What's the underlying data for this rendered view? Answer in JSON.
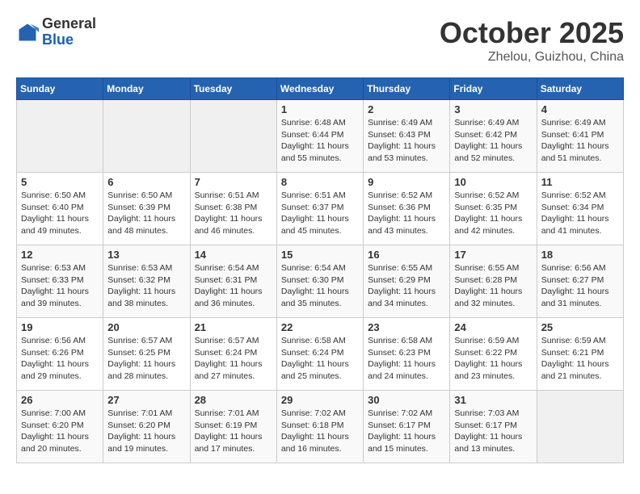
{
  "header": {
    "logo_general": "General",
    "logo_blue": "Blue",
    "title": "October 2025",
    "subtitle": "Zhelou, Guizhou, China"
  },
  "days_of_week": [
    "Sunday",
    "Monday",
    "Tuesday",
    "Wednesday",
    "Thursday",
    "Friday",
    "Saturday"
  ],
  "weeks": [
    [
      {
        "day": "",
        "info": ""
      },
      {
        "day": "",
        "info": ""
      },
      {
        "day": "",
        "info": ""
      },
      {
        "day": "1",
        "info": "Sunrise: 6:48 AM\nSunset: 6:44 PM\nDaylight: 11 hours\nand 55 minutes."
      },
      {
        "day": "2",
        "info": "Sunrise: 6:49 AM\nSunset: 6:43 PM\nDaylight: 11 hours\nand 53 minutes."
      },
      {
        "day": "3",
        "info": "Sunrise: 6:49 AM\nSunset: 6:42 PM\nDaylight: 11 hours\nand 52 minutes."
      },
      {
        "day": "4",
        "info": "Sunrise: 6:49 AM\nSunset: 6:41 PM\nDaylight: 11 hours\nand 51 minutes."
      }
    ],
    [
      {
        "day": "5",
        "info": "Sunrise: 6:50 AM\nSunset: 6:40 PM\nDaylight: 11 hours\nand 49 minutes."
      },
      {
        "day": "6",
        "info": "Sunrise: 6:50 AM\nSunset: 6:39 PM\nDaylight: 11 hours\nand 48 minutes."
      },
      {
        "day": "7",
        "info": "Sunrise: 6:51 AM\nSunset: 6:38 PM\nDaylight: 11 hours\nand 46 minutes."
      },
      {
        "day": "8",
        "info": "Sunrise: 6:51 AM\nSunset: 6:37 PM\nDaylight: 11 hours\nand 45 minutes."
      },
      {
        "day": "9",
        "info": "Sunrise: 6:52 AM\nSunset: 6:36 PM\nDaylight: 11 hours\nand 43 minutes."
      },
      {
        "day": "10",
        "info": "Sunrise: 6:52 AM\nSunset: 6:35 PM\nDaylight: 11 hours\nand 42 minutes."
      },
      {
        "day": "11",
        "info": "Sunrise: 6:52 AM\nSunset: 6:34 PM\nDaylight: 11 hours\nand 41 minutes."
      }
    ],
    [
      {
        "day": "12",
        "info": "Sunrise: 6:53 AM\nSunset: 6:33 PM\nDaylight: 11 hours\nand 39 minutes."
      },
      {
        "day": "13",
        "info": "Sunrise: 6:53 AM\nSunset: 6:32 PM\nDaylight: 11 hours\nand 38 minutes."
      },
      {
        "day": "14",
        "info": "Sunrise: 6:54 AM\nSunset: 6:31 PM\nDaylight: 11 hours\nand 36 minutes."
      },
      {
        "day": "15",
        "info": "Sunrise: 6:54 AM\nSunset: 6:30 PM\nDaylight: 11 hours\nand 35 minutes."
      },
      {
        "day": "16",
        "info": "Sunrise: 6:55 AM\nSunset: 6:29 PM\nDaylight: 11 hours\nand 34 minutes."
      },
      {
        "day": "17",
        "info": "Sunrise: 6:55 AM\nSunset: 6:28 PM\nDaylight: 11 hours\nand 32 minutes."
      },
      {
        "day": "18",
        "info": "Sunrise: 6:56 AM\nSunset: 6:27 PM\nDaylight: 11 hours\nand 31 minutes."
      }
    ],
    [
      {
        "day": "19",
        "info": "Sunrise: 6:56 AM\nSunset: 6:26 PM\nDaylight: 11 hours\nand 29 minutes."
      },
      {
        "day": "20",
        "info": "Sunrise: 6:57 AM\nSunset: 6:25 PM\nDaylight: 11 hours\nand 28 minutes."
      },
      {
        "day": "21",
        "info": "Sunrise: 6:57 AM\nSunset: 6:24 PM\nDaylight: 11 hours\nand 27 minutes."
      },
      {
        "day": "22",
        "info": "Sunrise: 6:58 AM\nSunset: 6:24 PM\nDaylight: 11 hours\nand 25 minutes."
      },
      {
        "day": "23",
        "info": "Sunrise: 6:58 AM\nSunset: 6:23 PM\nDaylight: 11 hours\nand 24 minutes."
      },
      {
        "day": "24",
        "info": "Sunrise: 6:59 AM\nSunset: 6:22 PM\nDaylight: 11 hours\nand 23 minutes."
      },
      {
        "day": "25",
        "info": "Sunrise: 6:59 AM\nSunset: 6:21 PM\nDaylight: 11 hours\nand 21 minutes."
      }
    ],
    [
      {
        "day": "26",
        "info": "Sunrise: 7:00 AM\nSunset: 6:20 PM\nDaylight: 11 hours\nand 20 minutes."
      },
      {
        "day": "27",
        "info": "Sunrise: 7:01 AM\nSunset: 6:20 PM\nDaylight: 11 hours\nand 19 minutes."
      },
      {
        "day": "28",
        "info": "Sunrise: 7:01 AM\nSunset: 6:19 PM\nDaylight: 11 hours\nand 17 minutes."
      },
      {
        "day": "29",
        "info": "Sunrise: 7:02 AM\nSunset: 6:18 PM\nDaylight: 11 hours\nand 16 minutes."
      },
      {
        "day": "30",
        "info": "Sunrise: 7:02 AM\nSunset: 6:17 PM\nDaylight: 11 hours\nand 15 minutes."
      },
      {
        "day": "31",
        "info": "Sunrise: 7:03 AM\nSunset: 6:17 PM\nDaylight: 11 hours\nand 13 minutes."
      },
      {
        "day": "",
        "info": ""
      }
    ]
  ]
}
